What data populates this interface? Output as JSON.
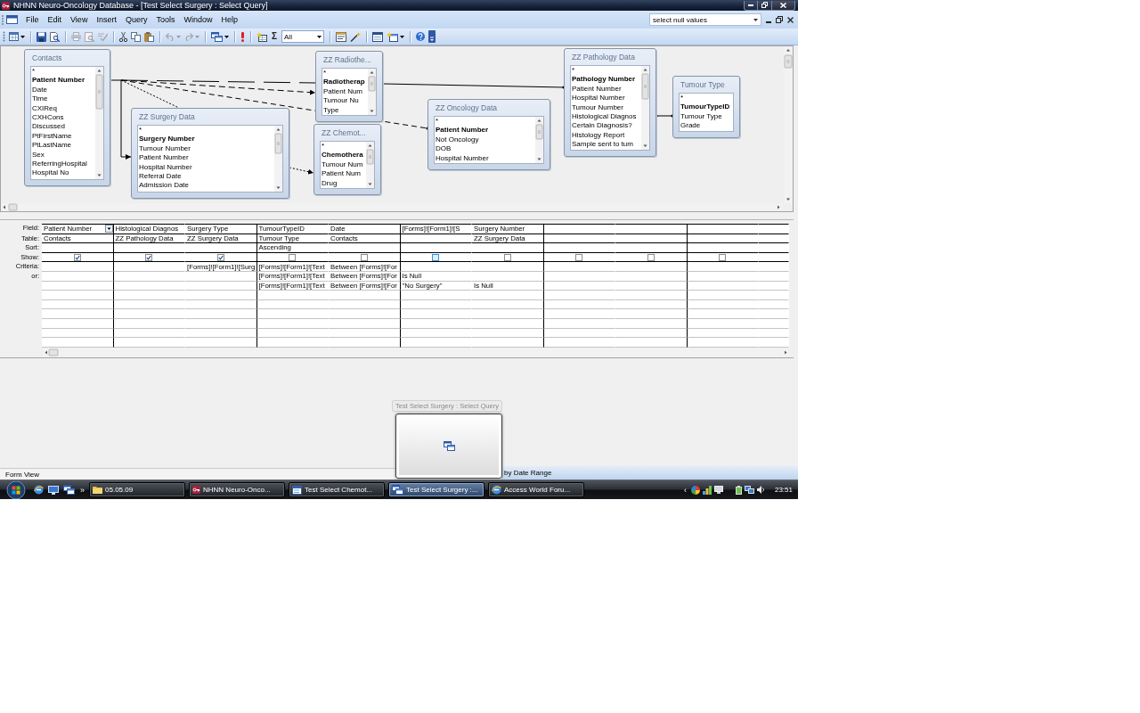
{
  "window": {
    "title": "NHNN Neuro-Oncology Database - [Test Select Surgery : Select Query]"
  },
  "menu_bar": {
    "items": [
      "File",
      "Edit",
      "View",
      "Insert",
      "Query",
      "Tools",
      "Window",
      "Help"
    ],
    "help_box": {
      "value": "select null values"
    }
  },
  "toolbar": {
    "totals_label": "Σ",
    "top_values": {
      "value": "All"
    }
  },
  "field_lists": [
    {
      "title": "Contacts",
      "fields": [
        {
          "name": "*",
          "key": false
        },
        {
          "name": "Patient Number",
          "key": true
        },
        {
          "name": "Date",
          "key": false
        },
        {
          "name": "Time",
          "key": false
        },
        {
          "name": "CXIReq",
          "key": false
        },
        {
          "name": "CXHCons",
          "key": false
        },
        {
          "name": "Discussed",
          "key": false
        },
        {
          "name": "PtFirstName",
          "key": false
        },
        {
          "name": "PtLastName",
          "key": false
        },
        {
          "name": "Sex",
          "key": false
        },
        {
          "name": "ReferringHospital",
          "key": false
        },
        {
          "name": "Hospital No",
          "key": false
        }
      ]
    },
    {
      "title": "ZZ Surgery Data",
      "fields": [
        {
          "name": "*",
          "key": false
        },
        {
          "name": "Surgery Number",
          "key": true
        },
        {
          "name": "Tumour Number",
          "key": false
        },
        {
          "name": "Patient Number",
          "key": false
        },
        {
          "name": "Hospital Number",
          "key": false
        },
        {
          "name": "Referral Date",
          "key": false
        },
        {
          "name": "Admission Date",
          "key": false
        }
      ]
    },
    {
      "title": "ZZ Radiothe...",
      "fields": [
        {
          "name": "*",
          "key": false
        },
        {
          "name": "Radiotherap",
          "key": true
        },
        {
          "name": "Patient Num",
          "key": false
        },
        {
          "name": "Tumour Nu",
          "key": false
        },
        {
          "name": "Type",
          "key": false
        }
      ]
    },
    {
      "title": "ZZ Chemot...",
      "fields": [
        {
          "name": "*",
          "key": false
        },
        {
          "name": "Chemothera",
          "key": true
        },
        {
          "name": "Tumour Num",
          "key": false
        },
        {
          "name": "Patient Num",
          "key": false
        },
        {
          "name": "Drug",
          "key": false
        }
      ]
    },
    {
      "title": "ZZ Oncology Data",
      "fields": [
        {
          "name": "*",
          "key": false
        },
        {
          "name": "Patient Number",
          "key": true
        },
        {
          "name": "Not Oncology",
          "key": false
        },
        {
          "name": "DOB",
          "key": false
        },
        {
          "name": "Hospital Number",
          "key": false
        }
      ]
    },
    {
      "title": "ZZ Pathology Data",
      "fields": [
        {
          "name": "*",
          "key": false
        },
        {
          "name": "Pathology Number",
          "key": true
        },
        {
          "name": "Patient Number",
          "key": false
        },
        {
          "name": "Hospital Number",
          "key": false
        },
        {
          "name": "Tumour Number",
          "key": false
        },
        {
          "name": "Histological Diagnos",
          "key": false
        },
        {
          "name": "Certain Diagnosis?",
          "key": false
        },
        {
          "name": "Histology Report",
          "key": false
        },
        {
          "name": "Sample sent to tum",
          "key": false
        }
      ]
    },
    {
      "title": "Tumour Type",
      "fields": [
        {
          "name": "*",
          "key": false
        },
        {
          "name": "TumourTypeID",
          "key": true
        },
        {
          "name": "Tumour Type",
          "key": false
        },
        {
          "name": "Grade",
          "key": false
        }
      ]
    }
  ],
  "design_grid": {
    "row_labels": [
      "Field:",
      "Table:",
      "Sort:",
      "Show:",
      "Criteria:",
      "or:"
    ],
    "columns": [
      {
        "field": "Patient Number",
        "table": "Contacts",
        "show": true,
        "selected": true,
        "highlighted": false
      },
      {
        "field": "Histological Diagnos",
        "table": "ZZ Pathology Data",
        "show": true,
        "selected": false,
        "highlighted": false
      },
      {
        "field": "Surgery Type",
        "table": "ZZ Surgery Data",
        "show": true,
        "selected": false,
        "highlighted": false,
        "criteria": {
          "line_1": "[Forms]![Form1]![Surg"
        }
      },
      {
        "field": "TumourTypeID",
        "table": "Tumour Type",
        "sort": "Ascending",
        "show": false,
        "selected": false,
        "highlighted": false,
        "criteria": {
          "line_1": "[Forms]![Form1]![Text",
          "line_2": "[Forms]![Form1]![Text",
          "line_3": "[Forms]![Form1]![Text"
        }
      },
      {
        "field": "Date",
        "table": "Contacts",
        "show": false,
        "selected": false,
        "highlighted": false,
        "criteria": {
          "line_1": "Between [Forms]![For",
          "line_2": "Between [Forms]![For",
          "line_3": "Between [Forms]![For"
        }
      },
      {
        "field": "[Forms]![Form1]![S",
        "show": false,
        "selected": false,
        "highlighted": true,
        "criteria": {
          "line_2": "Is Null",
          "line_3": "\"No Surgery\""
        }
      },
      {
        "field": "Surgery Number",
        "table": "ZZ Surgery Data",
        "show": false,
        "selected": false,
        "highlighted": false,
        "criteria": {
          "line_3": "Is Null"
        }
      },
      {
        "show": false,
        "selected": false,
        "highlighted": false
      },
      {
        "show": false,
        "selected": false,
        "highlighted": false
      },
      {
        "show": false,
        "selected": false,
        "highlighted": false
      }
    ]
  },
  "status_bar": {
    "text": "Form View"
  },
  "background_window": {
    "title": "by Date Range"
  },
  "taskbar_preview": {
    "title": "Test Select Surgery : Select Query"
  },
  "taskbar": {
    "overflow_label": "»",
    "buttons": [
      {
        "label": "05.05.09",
        "kind": "folder",
        "selected": false
      },
      {
        "label": "NHNN Neuro-Onco...",
        "kind": "database",
        "selected": false
      },
      {
        "label": "Test Select Chemot...",
        "kind": "form",
        "selected": false
      },
      {
        "label": "Test Select Surgery :...",
        "kind": "query",
        "selected": true
      },
      {
        "label": "Access World Foru...",
        "kind": "browser",
        "selected": false
      }
    ],
    "tray_toggle": "‹",
    "clock": "23:51"
  }
}
